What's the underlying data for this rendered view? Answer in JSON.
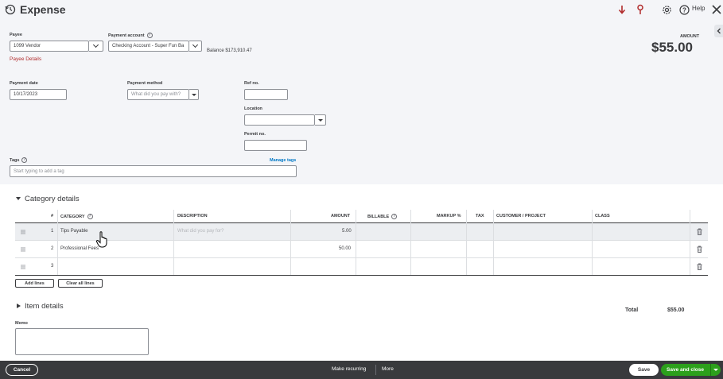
{
  "header": {
    "title": "Expense",
    "help_label": "Help"
  },
  "payee": {
    "label": "Payee",
    "value": "1099 Vendor",
    "details_link": "Payee Details"
  },
  "payment_account": {
    "label": "Payment account",
    "value": "Checking Account - Super Fun Ba",
    "balance": "Balance $173,910.47"
  },
  "amount": {
    "label": "AMOUNT",
    "value": "$55.00"
  },
  "payment_date": {
    "label": "Payment date",
    "value": "10/17/2023"
  },
  "payment_method": {
    "label": "Payment method",
    "placeholder": "What did you pay with?"
  },
  "ref_no": {
    "label": "Ref no.",
    "value": ""
  },
  "location": {
    "label": "Location",
    "value": ""
  },
  "permit_no": {
    "label": "Permit no.",
    "value": ""
  },
  "tags": {
    "label": "Tags",
    "manage_link": "Manage tags",
    "placeholder": "Start typing to add a tag"
  },
  "category_details": {
    "title": "Category details",
    "columns": {
      "num": "#",
      "category": "CATEGORY",
      "description": "DESCRIPTION",
      "amount": "AMOUNT",
      "billable": "BILLABLE",
      "markup": "MARKUP %",
      "tax": "TAX",
      "customer": "CUSTOMER / PROJECT",
      "class": "CLASS"
    },
    "rows": [
      {
        "num": "1",
        "category": "Tips Payable",
        "description_placeholder": "What did you pay for?",
        "amount": "5.00"
      },
      {
        "num": "2",
        "category": "Professional Fees",
        "description_placeholder": "",
        "amount": "50.00"
      },
      {
        "num": "3",
        "category": "",
        "description_placeholder": "",
        "amount": ""
      }
    ],
    "add_lines": "Add lines",
    "clear_all_lines": "Clear all lines"
  },
  "item_details": {
    "title": "Item details"
  },
  "total": {
    "label": "Total",
    "value": "$55.00"
  },
  "memo": {
    "label": "Memo",
    "value": ""
  },
  "footer": {
    "cancel": "Cancel",
    "make_recurring": "Make recurring",
    "more": "More",
    "save": "Save",
    "save_and_close": "Save and close"
  },
  "colors": {
    "accent_green": "#2ca01c",
    "link_blue": "#0077c5",
    "link_red": "#b12b2b",
    "footer_bg": "#393a3d",
    "header_bg": "#f4f5f8"
  }
}
